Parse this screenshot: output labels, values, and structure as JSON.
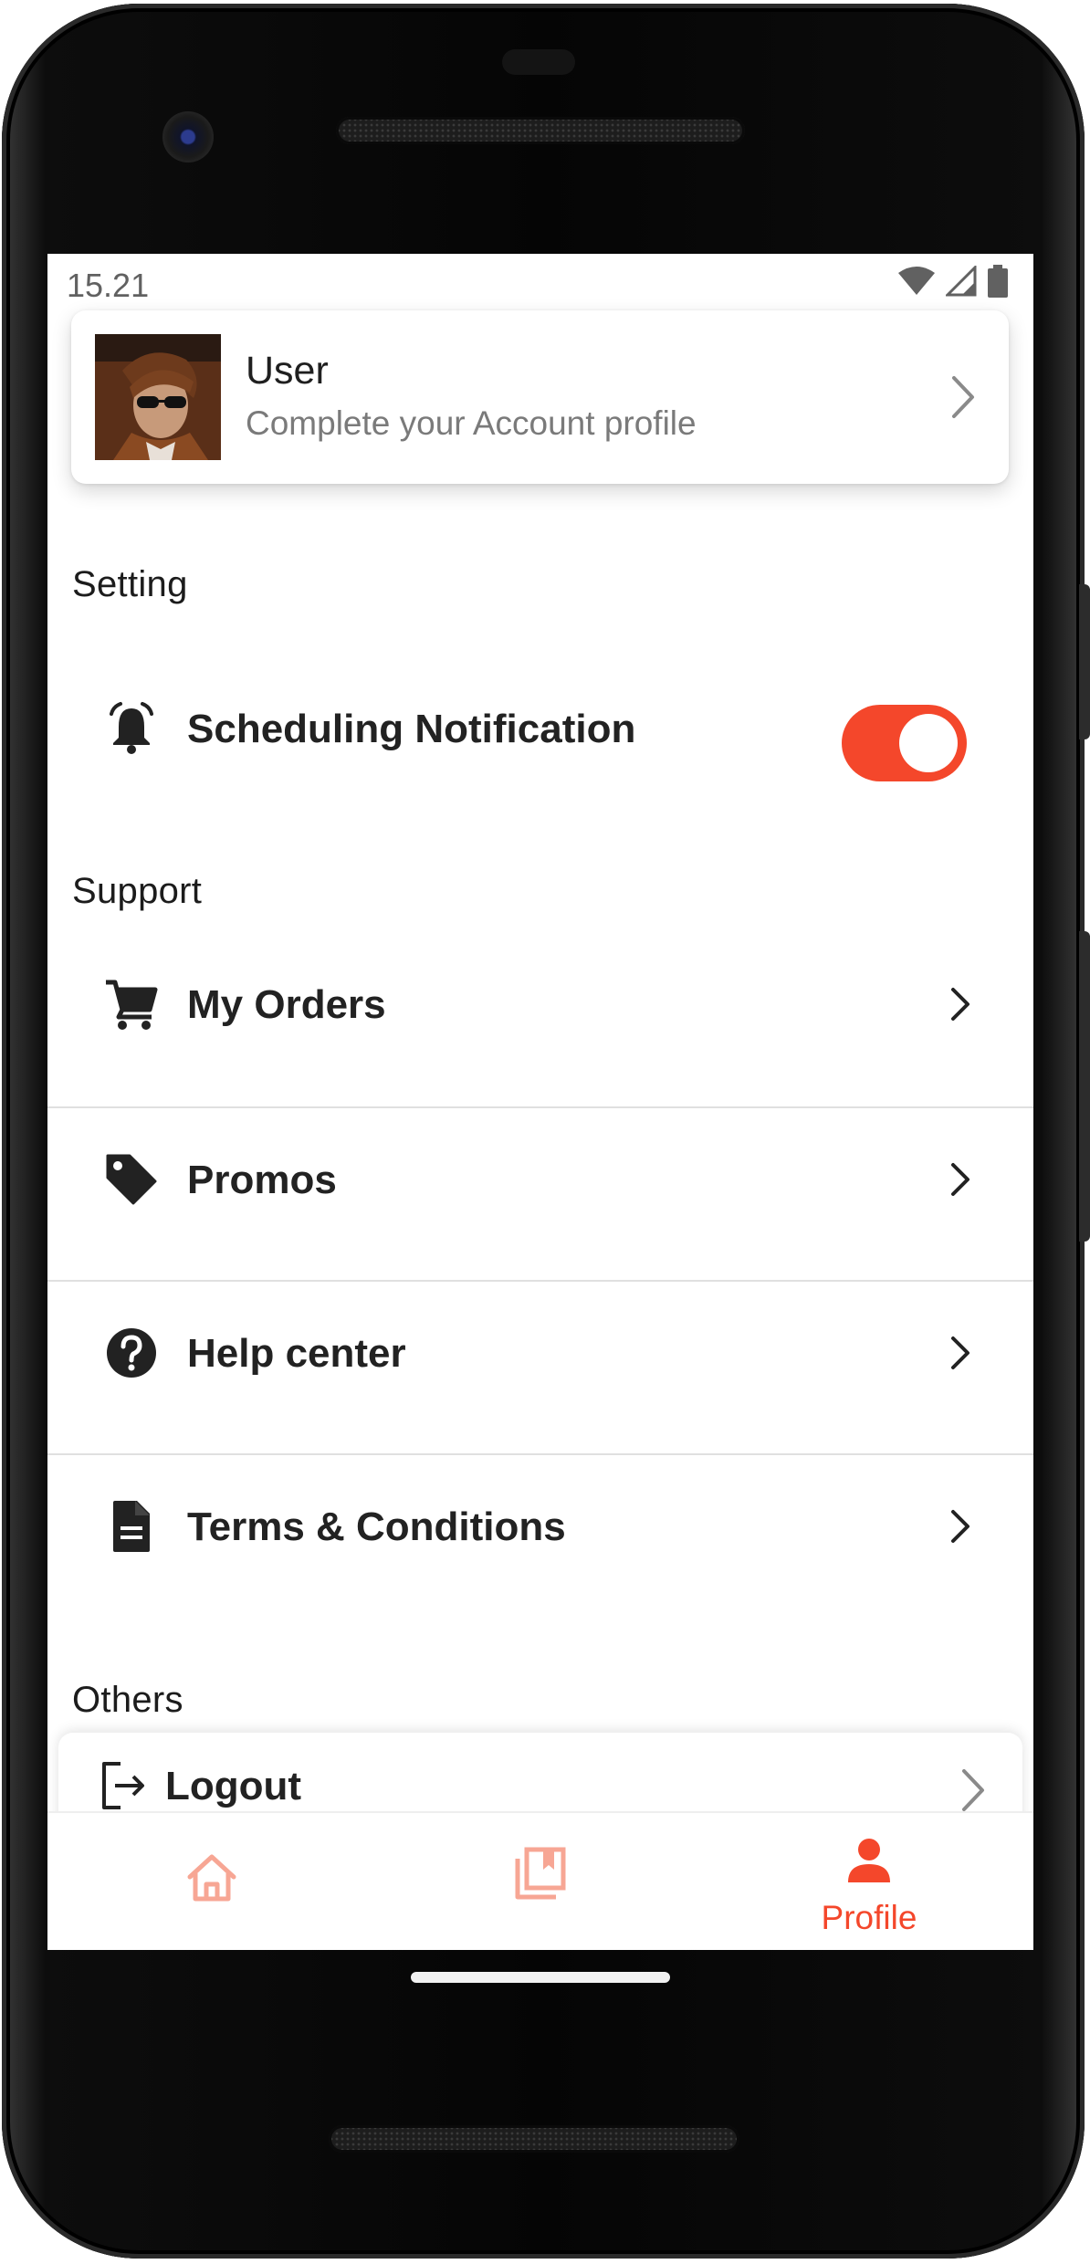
{
  "status_bar": {
    "time": "15.21",
    "icons": [
      "wifi-icon",
      "signal-icon",
      "battery-icon"
    ]
  },
  "profile": {
    "name": "User",
    "subtitle": "Complete your Account profile"
  },
  "sections": {
    "setting": "Setting",
    "support": "Support",
    "others": "Others"
  },
  "setting_items": [
    {
      "label": "Scheduling Notification",
      "icon": "alarm-bell-icon",
      "toggle_on": true
    }
  ],
  "support_items": [
    {
      "label": "My Orders",
      "icon": "cart-icon"
    },
    {
      "label": "Promos",
      "icon": "tag-icon"
    },
    {
      "label": "Help center",
      "icon": "help-circle-icon"
    },
    {
      "label": "Terms & Conditions",
      "icon": "document-icon"
    }
  ],
  "others_items": [
    {
      "label": "Logout",
      "icon": "logout-icon"
    }
  ],
  "bottom_nav": [
    {
      "label": "",
      "icon": "home-icon",
      "active": false
    },
    {
      "label": "",
      "icon": "bookmarks-icon",
      "active": false
    },
    {
      "label": "Profile",
      "icon": "person-icon",
      "active": true
    }
  ],
  "colors": {
    "accent": "#f4472b",
    "accent_inactive": "#f7a694",
    "text": "#222222",
    "subtext": "#7a7a7a"
  }
}
